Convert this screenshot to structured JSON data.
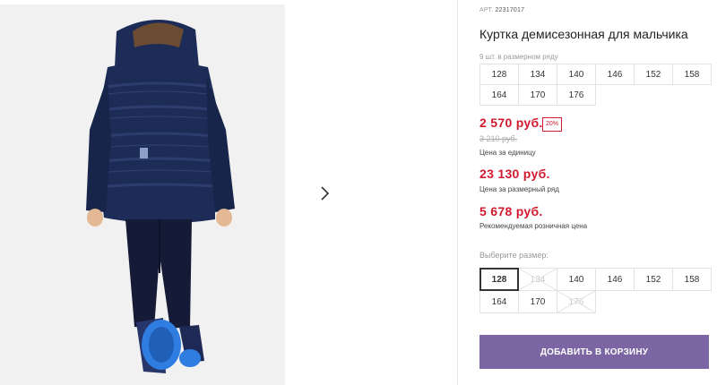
{
  "product": {
    "sku_label": "АРТ.",
    "sku_value": "22317017",
    "title": "Куртка демисезонная для мальчика"
  },
  "size_row": {
    "count_label": "9 шт. в размерном ряду",
    "sizes": [
      "128",
      "134",
      "140",
      "146",
      "152",
      "158",
      "164",
      "170",
      "176"
    ]
  },
  "prices": {
    "unit_price": "2 570 руб.",
    "discount": "20%",
    "old_price": "3 210 руб.",
    "unit_caption": "Цена за единицу",
    "set_price": "23 130 руб.",
    "set_caption": "Цена за размерный ряд",
    "rrp_price": "5 678 руб.",
    "rrp_caption": "Рекомендуемая розничная цена"
  },
  "size_select": {
    "label": "Выберите размер:",
    "options": [
      {
        "label": "128",
        "state": "selected"
      },
      {
        "label": "134",
        "state": "unavailable"
      },
      {
        "label": "140",
        "state": "available"
      },
      {
        "label": "146",
        "state": "available"
      },
      {
        "label": "152",
        "state": "available"
      },
      {
        "label": "158",
        "state": "available"
      },
      {
        "label": "164",
        "state": "available"
      },
      {
        "label": "170",
        "state": "available"
      },
      {
        "label": "176",
        "state": "unavailable"
      }
    ]
  },
  "cart": {
    "button_label": "ДОБАВИТЬ В КОРЗИНУ"
  },
  "gallery": {
    "next_icon": "chevron-right-icon"
  },
  "colors": {
    "accent": "#7b66a3",
    "price_red": "#d1192f",
    "jacket": "#1d2c57"
  }
}
